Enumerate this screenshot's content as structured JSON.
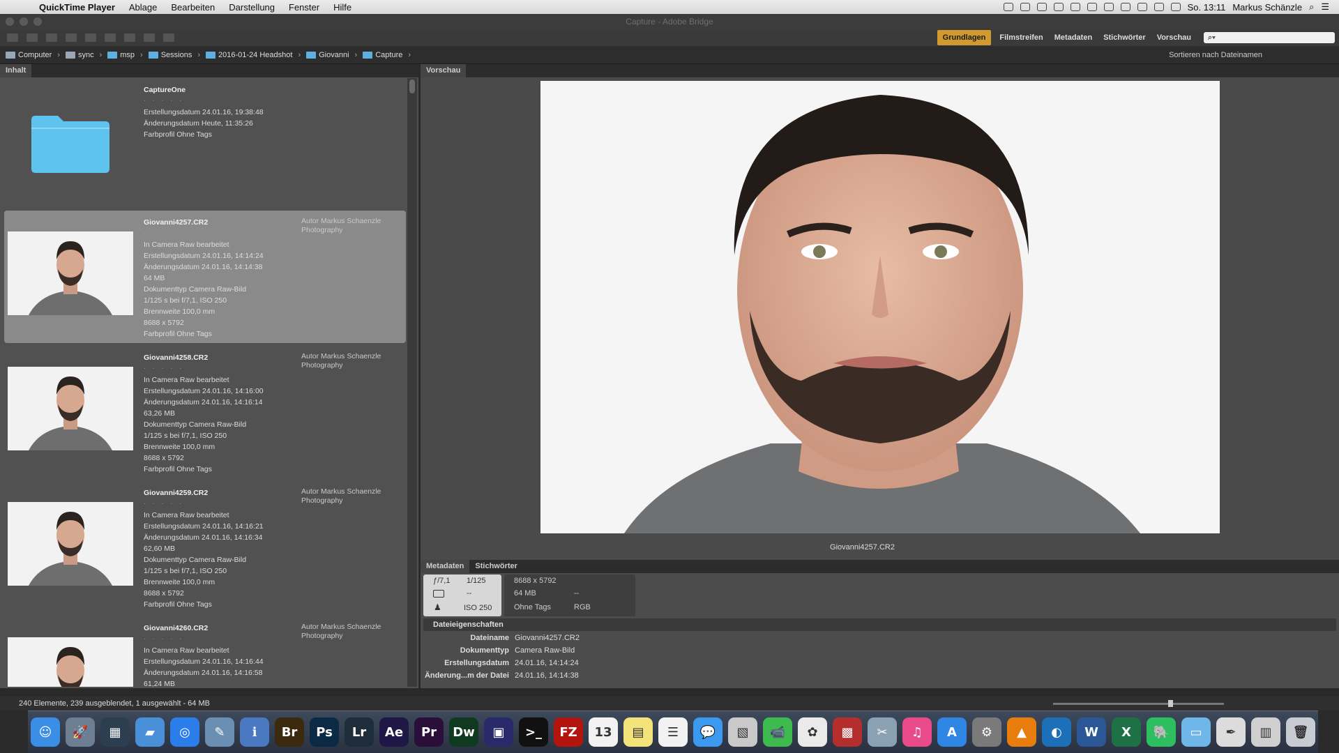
{
  "menubar": {
    "apple": "",
    "app": "QuickTime Player",
    "items": [
      "Ablage",
      "Bearbeiten",
      "Darstellung",
      "Fenster",
      "Hilfe"
    ],
    "clock": "So. 13:11",
    "user": "Markus Schänzle"
  },
  "window": {
    "title": "Capture - Adobe Bridge"
  },
  "workspaces": [
    "Grundlagen",
    "Filmstreifen",
    "Metadaten",
    "Stichwörter",
    "Vorschau"
  ],
  "search": {
    "placeholder": "⌕▾"
  },
  "path": [
    "Computer",
    "sync",
    "msp",
    "Sessions",
    "2016-01-24 Headshot",
    "Giovanni",
    "Capture"
  ],
  "sort_label": "Sortieren nach Dateinamen",
  "content_panel": {
    "tab": "Inhalt",
    "folder": {
      "name": "CaptureOne",
      "stars": "· · · · ·",
      "created": "Erstellungsdatum 24.01.16, 19:38:48",
      "modified": "Änderungsdatum Heute, 11:35:26",
      "profile": "Farbprofil Ohne Tags"
    },
    "items": [
      {
        "name": "Giovanni4257.CR2",
        "stars": "· · · · ·",
        "author": "Autor Markus Schaenzle Photography",
        "raw": "In Camera Raw bearbeitet",
        "created": "Erstellungsdatum 24.01.16, 14:14:24",
        "modified": "Änderungsdatum 24.01.16, 14:14:38",
        "size": "64 MB",
        "doctype": "Dokumenttyp Camera Raw-Bild",
        "exposure": "1/125 s bei f/7,1, ISO 250",
        "focal": "Brennweite 100,0 mm",
        "dims": "8688 x 5792",
        "profile": "Farbprofil Ohne Tags"
      },
      {
        "name": "Giovanni4258.CR2",
        "stars": "· · · · ·",
        "author": "Autor Markus Schaenzle Photography",
        "raw": "In Camera Raw bearbeitet",
        "created": "Erstellungsdatum 24.01.16, 14:16:00",
        "modified": "Änderungsdatum 24.01.16, 14:16:14",
        "size": "63,26 MB",
        "doctype": "Dokumenttyp Camera Raw-Bild",
        "exposure": "1/125 s bei f/7,1, ISO 250",
        "focal": "Brennweite 100,0 mm",
        "dims": "8688 x 5792",
        "profile": "Farbprofil Ohne Tags"
      },
      {
        "name": "Giovanni4259.CR2",
        "stars": "· · · · ·",
        "author": "Autor Markus Schaenzle Photography",
        "raw": "In Camera Raw bearbeitet",
        "created": "Erstellungsdatum 24.01.16, 14:16:21",
        "modified": "Änderungsdatum 24.01.16, 14:16:34",
        "size": "62,60 MB",
        "doctype": "Dokumenttyp Camera Raw-Bild",
        "exposure": "1/125 s bei f/7,1, ISO 250",
        "focal": "Brennweite 100,0 mm",
        "dims": "8688 x 5792",
        "profile": "Farbprofil Ohne Tags"
      },
      {
        "name": "Giovanni4260.CR2",
        "stars": "· · · · ·",
        "author": "Autor Markus Schaenzle Photography",
        "raw": "In Camera Raw bearbeitet",
        "created": "Erstellungsdatum 24.01.16, 14:16:44",
        "modified": "Änderungsdatum 24.01.16, 14:16:58",
        "size": "61,24 MB"
      }
    ]
  },
  "preview": {
    "tab": "Vorschau",
    "caption": "Giovanni4257.CR2"
  },
  "metadata": {
    "tabs": [
      "Metadaten",
      "Stichwörter"
    ],
    "exif": {
      "aperture": "ƒ/7,1",
      "shutter": "1/125",
      "metering": "--",
      "iso": "ISO 250"
    },
    "file": {
      "dims": "8688 x 5792",
      "size": "64 MB",
      "dash": "--",
      "profile": "Ohne Tags",
      "mode": "RGB"
    },
    "section": "Dateieigenschaften",
    "rows": [
      {
        "k": "Dateiname",
        "v": "Giovanni4257.CR2"
      },
      {
        "k": "Dokumenttyp",
        "v": "Camera Raw-Bild"
      },
      {
        "k": "Erstellungsdatum",
        "v": "24.01.16, 14:14:24"
      },
      {
        "k": "Änderung...m der Datei",
        "v": "24.01.16, 14:14:38"
      }
    ]
  },
  "status": "240 Elemente, 239 ausgeblendet, 1 ausgewählt - 64 MB",
  "dock": [
    {
      "name": "finder-icon",
      "color": "#3a8ee6",
      "label": "☺"
    },
    {
      "name": "launchpad-icon",
      "color": "#6d7d92",
      "label": "🚀"
    },
    {
      "name": "mission-control-icon",
      "color": "#2c3e50",
      "label": "▦"
    },
    {
      "name": "folder-icon",
      "color": "#4a90d9",
      "label": "▰"
    },
    {
      "name": "safari-icon",
      "color": "#2b7de9",
      "label": "◎"
    },
    {
      "name": "preview-icon",
      "color": "#6a8fb3",
      "label": "✎"
    },
    {
      "name": "info-icon",
      "color": "#4a79c2",
      "label": "ℹ"
    },
    {
      "name": "bridge-icon",
      "color": "#3b2a0d",
      "label": "Br"
    },
    {
      "name": "photoshop-icon",
      "color": "#0c2a43",
      "label": "Ps"
    },
    {
      "name": "lightroom-icon",
      "color": "#1e2d3a",
      "label": "Lr"
    },
    {
      "name": "after-effects-icon",
      "color": "#1f1746",
      "label": "Ae"
    },
    {
      "name": "premiere-icon",
      "color": "#2a0f3b",
      "label": "Pr"
    },
    {
      "name": "dreamweaver-icon",
      "color": "#0f3a1f",
      "label": "Dw"
    },
    {
      "name": "imovie-icon",
      "color": "#2a2a6a",
      "label": "▣"
    },
    {
      "name": "terminal-icon",
      "color": "#111111",
      "label": ">_"
    },
    {
      "name": "filezilla-icon",
      "color": "#b3140e",
      "label": "FZ"
    },
    {
      "name": "calendar-icon",
      "color": "#f2f2f2",
      "label": "13"
    },
    {
      "name": "notes-icon",
      "color": "#f4e27a",
      "label": "▤"
    },
    {
      "name": "reminders-icon",
      "color": "#f2f2f2",
      "label": "☰"
    },
    {
      "name": "messages-icon",
      "color": "#3b9af0",
      "label": "💬"
    },
    {
      "name": "photo-booth-icon",
      "color": "#c9c9c9",
      "label": "▧"
    },
    {
      "name": "facetime-icon",
      "color": "#3dbb4e",
      "label": "📹"
    },
    {
      "name": "photos-icon",
      "color": "#eaeaea",
      "label": "✿"
    },
    {
      "name": "photo-stack-icon",
      "color": "#b42e2e",
      "label": "▩"
    },
    {
      "name": "utility-icon",
      "color": "#8aa0b3",
      "label": "✂"
    },
    {
      "name": "itunes-icon",
      "color": "#e94b8a",
      "label": "♫"
    },
    {
      "name": "app-store-icon",
      "color": "#2f86e4",
      "label": "A"
    },
    {
      "name": "system-preferences-icon",
      "color": "#7a7a7a",
      "label": "⚙"
    },
    {
      "name": "vlc-icon",
      "color": "#e87d0d",
      "label": "▲"
    },
    {
      "name": "network-icon",
      "color": "#1d6fb8",
      "label": "◐"
    },
    {
      "name": "word-icon",
      "color": "#2b5797",
      "label": "W"
    },
    {
      "name": "excel-icon",
      "color": "#1e7145",
      "label": "X"
    },
    {
      "name": "evernote-icon",
      "color": "#2dbe60",
      "label": "🐘"
    },
    {
      "name": "downloads-folder-icon",
      "color": "#6fb7e8",
      "label": "▭"
    },
    {
      "name": "brushes-icon",
      "color": "#dcdcdc",
      "label": "✒"
    },
    {
      "name": "documents-stack-icon",
      "color": "#cfcfcf",
      "label": "▥"
    },
    {
      "name": "trash-icon",
      "color": "#c8ccd2",
      "label": "🗑"
    }
  ]
}
